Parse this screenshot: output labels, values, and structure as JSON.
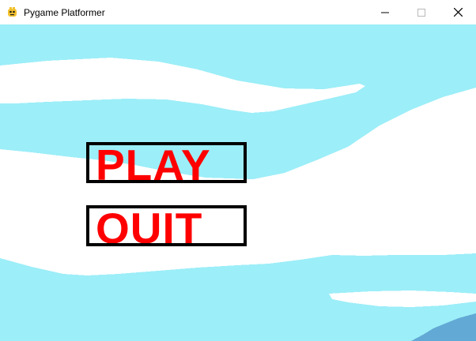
{
  "window": {
    "title": "Pygame Platformer",
    "icons": {
      "app": "pygame-snake-icon",
      "minimize": "minimize-icon",
      "maximize": "maximize-icon",
      "close": "close-icon"
    }
  },
  "menu": {
    "play_label": "PLAY",
    "quit_label": "QUIT"
  },
  "colors": {
    "sky": "#9ceef8",
    "cloud": "#ffffff",
    "hill": "#63a9d5",
    "button_text": "#ff0000",
    "button_border": "#000000"
  }
}
